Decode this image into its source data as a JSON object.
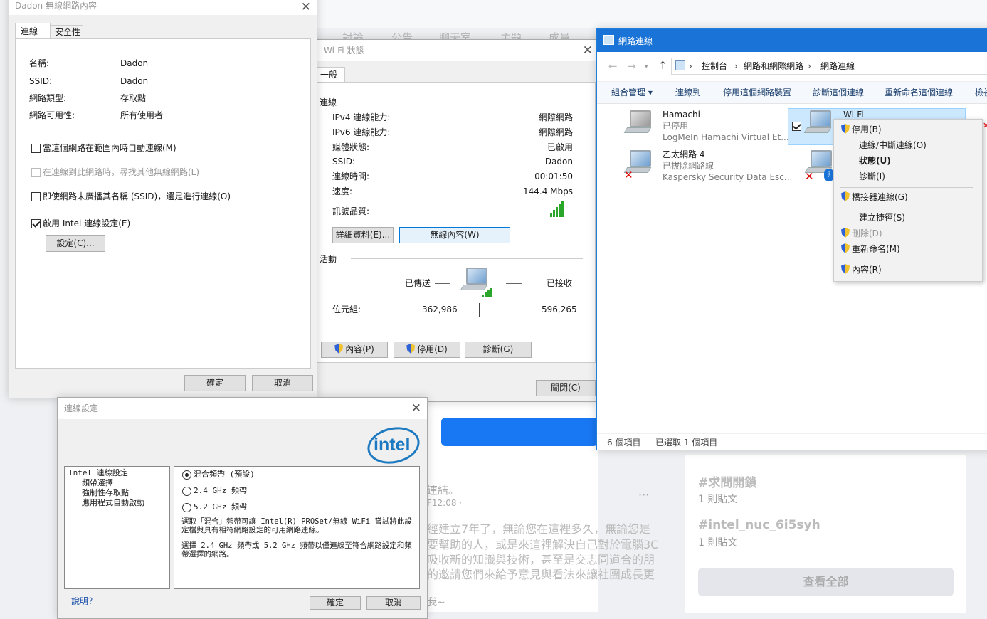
{
  "bg": {
    "tabs": [
      "討論",
      "公告",
      "聊天室",
      "主題",
      "成員"
    ],
    "lines": [
      "連結。",
      "F12:08 ·",
      "經建立7年了，無論您在這裡多久，無論您是",
      "要幫助的人，或是來這裡解決自己對於電腦3C",
      "吸收新的知識與技術，甚至是交志同道合的朋",
      "的邀請您們來給予意見與看法來讓社團成長更",
      "我~"
    ],
    "hashtag1": "#求問開鎖",
    "count1": "1 則貼文",
    "hashtag2": "#intel_nuc_6i5syh",
    "count2": "1 則貼文",
    "see_all": "查看全部",
    "more": "···"
  },
  "props": {
    "title": "Dadon 無線網路內容",
    "tabs": [
      "連線",
      "安全性"
    ],
    "labels": [
      "名稱:",
      "SSID:",
      "網路類型:",
      "網路可用性:"
    ],
    "values": [
      "Dadon",
      "Dadon",
      "存取點",
      "所有使用者"
    ],
    "opt1": "當這個網路在範圍內時自動連線(M)",
    "opt2": "在連線到此網路時，尋找其他無線網路(L)",
    "opt3": "即使網路未廣播其名稱 (SSID)，還是進行連線(O)",
    "opt4": "啟用 Intel 連線設定(E)",
    "settings": "設定(C)...",
    "ok": "確定",
    "cancel": "取消"
  },
  "status": {
    "title": "Wi-Fi 狀態",
    "tab": "一般",
    "conn_group": "連線",
    "rows": [
      [
        "IPv4 連線能力:",
        "網際網路"
      ],
      [
        "IPv6 連線能力:",
        "網際網路"
      ],
      [
        "媒體狀態:",
        "已啟用"
      ],
      [
        "SSID:",
        "Dadon"
      ],
      [
        "連線時間:",
        "00:01:50"
      ],
      [
        "速度:",
        "144.4 Mbps"
      ]
    ],
    "signal": "訊號品質:",
    "details": "詳細資料(E)...",
    "wireless_props": "無線內容(W)",
    "activity": "活動",
    "sent": "已傳送",
    "recv": "已接收",
    "bytes": "位元組:",
    "sent_val": "362,986",
    "recv_val": "596,265",
    "props_btn": "內容(P)",
    "disable": "停用(D)",
    "diagnose": "診斷(G)",
    "close": "關閉(C)"
  },
  "netconn": {
    "title": "網路連線",
    "crumbs": [
      "控制台",
      "網路和網際網路",
      "網路連線"
    ],
    "toolbar": [
      "組合管理 ▾",
      "連線到",
      "停用這個網路裝置",
      "診斷這個連線",
      "重新命名這個連線",
      "檢視"
    ],
    "items": [
      {
        "name": "Hamachi",
        "status": "已停用",
        "device": "LogMeIn Hamachi Virtual Et..."
      },
      {
        "name": "乙太網路 4",
        "status": "已拔除網路線",
        "device": "Kaspersky Security Data Esc..."
      },
      {
        "name": "Wi-Fi",
        "status": "",
        "device": ""
      }
    ],
    "footer_count": "6 個項目",
    "footer_sel": "已選取 1 個項目"
  },
  "ctx": {
    "items": [
      "停用(B)",
      "連線/中斷連線(O)",
      "狀態(U)",
      "診斷(I)",
      "橋接器連線(G)",
      "建立捷徑(S)",
      "刪除(D)",
      "重新命名(M)",
      "內容(R)"
    ]
  },
  "intel": {
    "title": "連線設定",
    "logo": "intel",
    "tree": [
      "Intel 連線設定",
      "頻帶選擇",
      "強制性存取點",
      "應用程式自動啟動"
    ],
    "radios": [
      "混合頻帶 (預設)",
      "2.4 GHz 頻帶",
      "5.2 GHz 頻帶"
    ],
    "desc1": "選取「混合」頻帶可讓 Intel(R) PROSet/無線 WiFi 嘗試將此設定檔與具有相符網路設定的可用網路連線。",
    "desc2": "選擇 2.4 GHz 頻帶或 5.2 GHz 頻帶以僅連線至符合網路設定和頻帶選擇的網路。",
    "help": "說明？",
    "ok": "確定",
    "cancel": "取消"
  }
}
